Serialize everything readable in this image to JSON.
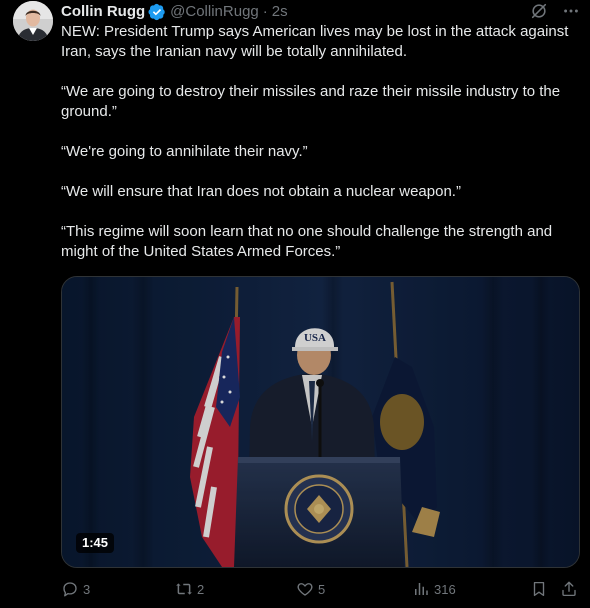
{
  "tweet": {
    "author": {
      "display_name": "Collin Rugg",
      "handle": "@CollinRugg",
      "verified": true,
      "verified_color": "#1d9bf0"
    },
    "separator": "·",
    "time": "2s",
    "paragraphs": [
      "NEW: President Trump says American lives may be lost in the attack against Iran, says the Iranian navy will be totally annihilated.",
      "“We are going to destroy their missiles and raze their missile industry to the ground.”",
      "“We're going to annihilate their navy.”",
      "“We will ensure that Iran does not obtain a nuclear weapon.”",
      "“This regime will soon learn that no one should challenge the strength and might of the United States Armed Forces.”"
    ],
    "media": {
      "type": "video",
      "duration": "1:45",
      "hat_text": "USA"
    },
    "actions": {
      "replies": "3",
      "reposts": "2",
      "likes": "5",
      "views": "316"
    },
    "icons": {
      "header": [
        "grok-icon",
        "more-icon"
      ],
      "actions": [
        "reply-icon",
        "repost-icon",
        "like-icon",
        "views-icon",
        "bookmark-icon",
        "share-icon"
      ]
    }
  }
}
